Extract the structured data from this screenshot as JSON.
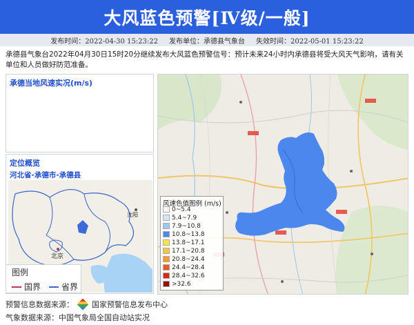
{
  "header": {
    "title": "大风蓝色预警[Ⅳ级/一般]"
  },
  "meta": {
    "publish_time": "发布时间：2022-04-30 15:23:22",
    "publisher": "发布单位：承德县气象台",
    "expire_time": "失效时间：2022-05-01 15:23:22"
  },
  "description": "承德县气象台2022年04月30日15时20分继续发布大风蓝色预警信号：预计未来24小时内承德县将受大风天气影响，请有关单位和人员做好防范准备。",
  "wind_panel": {
    "title": "承德当地风速实况(m/s)"
  },
  "location_panel": {
    "title": "定位概览",
    "subtitle": "河北省-承德市-承德县",
    "map_labels": {
      "beijing": "北京",
      "shenyang": "沈阳"
    }
  },
  "map_legend": {
    "title": "图例",
    "national_border": "国界",
    "province_border": "省界",
    "national_color": "#c0394b",
    "province_color": "#3a63c9"
  },
  "speed_legend": {
    "title": "风速色值图例 (m/s)",
    "items": [
      {
        "label": "0~5.4",
        "color": "#f7f7f7"
      },
      {
        "label": "5.4~7.9",
        "color": "#d6e6f7"
      },
      {
        "label": "7.9~10.8",
        "color": "#9fc8f0"
      },
      {
        "label": "10.8~13.8",
        "color": "#4c87ee"
      },
      {
        "label": "13.8~17.1",
        "color": "#f4e542"
      },
      {
        "label": "17.1~20.8",
        "color": "#f6c744"
      },
      {
        "label": "20.8~24.4",
        "color": "#f59d2a"
      },
      {
        "label": "24.4~28.4",
        "color": "#ee5a1c"
      },
      {
        "label": "28.4~32.6",
        "color": "#d42a12"
      },
      {
        "label": ">32.6",
        "color": "#9a0d0d"
      }
    ]
  },
  "warning_area_color": "#4c87ee",
  "footer": {
    "source1_label": "预警信息数据来源：",
    "source1_value": "国家预警信息发布中心",
    "source2": "气象数据来源：中国气象局全国自动站实况"
  }
}
